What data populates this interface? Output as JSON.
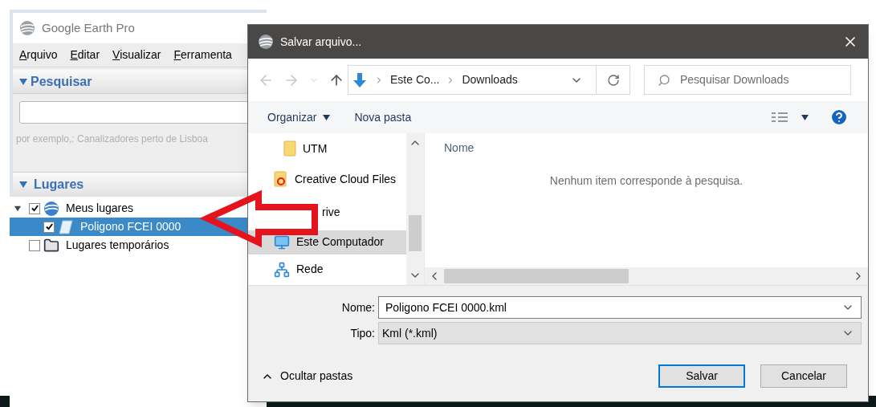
{
  "app": {
    "title": "Google Earth Pro",
    "menu": [
      "Arquivo",
      "Editar",
      "Visualizar",
      "Ferramenta"
    ],
    "search_panel": {
      "title": "Pesquisar",
      "expanded": true,
      "hint": "por exemplo,: Canalizadores perto de Lisboa"
    },
    "places_panel": {
      "title": "Lugares",
      "expanded": true,
      "tree": [
        {
          "label": "Meus lugares",
          "checked": true,
          "selected": false,
          "expanded": true,
          "kind": "globe",
          "children": [
            {
              "label": "Poligono FCEI 0000",
              "checked": true,
              "selected": true,
              "kind": "polygon"
            }
          ]
        },
        {
          "label": "Lugares temporários",
          "checked": false,
          "selected": false,
          "kind": "folder"
        }
      ]
    }
  },
  "dialog": {
    "title": "Salvar arquivo...",
    "breadcrumb": [
      "Este Co...",
      "Downloads"
    ],
    "search": {
      "placeholder": "Pesquisar Downloads"
    },
    "toolbar": [
      "Organizar",
      "Nova pasta"
    ],
    "nav_items": [
      {
        "label": "UTM",
        "kind": "folder",
        "selected": false
      },
      {
        "label": "Creative Cloud Files",
        "kind": "cloud-folder",
        "selected": false
      },
      {
        "label": "rive",
        "kind": "hidden",
        "selected": false
      },
      {
        "label": "Este Computador",
        "kind": "computer",
        "selected": true
      },
      {
        "label": "Rede",
        "kind": "network",
        "selected": false
      }
    ],
    "column": "Nome",
    "empty_message": "Nenhum item corresponde à pesquisa.",
    "fields": [
      {
        "label": "Nome:",
        "value": "Poligono FCEI 0000.kml",
        "kind": "input"
      },
      {
        "label": "Tipo:",
        "value": "Kml (*.kml)",
        "kind": "select"
      }
    ],
    "hide_folders": "Ocultar pastas",
    "buttons": [
      {
        "label": "Salvar",
        "default": true
      },
      {
        "label": "Cancelar",
        "default": false
      }
    ]
  }
}
